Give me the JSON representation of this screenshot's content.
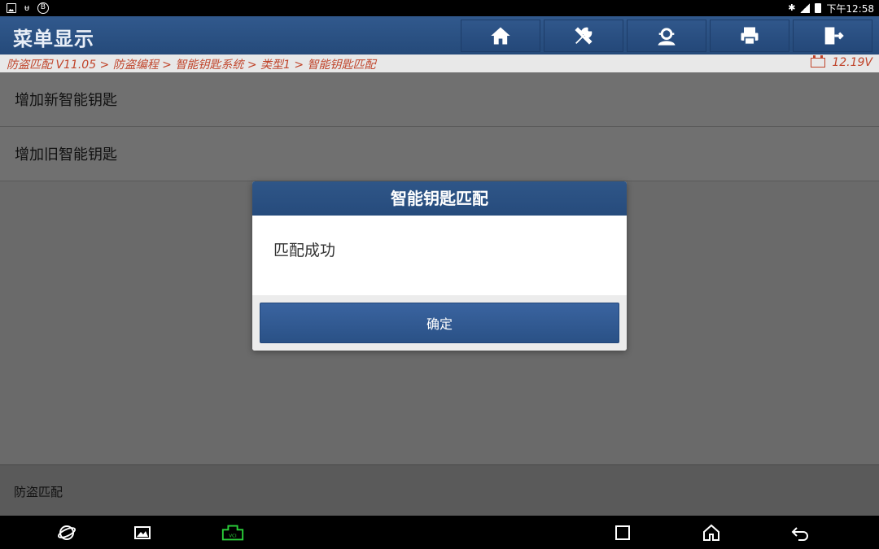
{
  "status_bar": {
    "left_icons": [
      "image-icon",
      "usb-icon",
      "bluetooth-circle-icon"
    ],
    "usb_glyph": "ᵾ",
    "bt_glyph": "B",
    "time": "下午12:58",
    "bluetooth_glyph": "✱"
  },
  "header": {
    "title": "菜单显示",
    "tools": [
      "home-icon",
      "diagnostic-icon",
      "user-icon",
      "print-icon",
      "exit-icon"
    ]
  },
  "breadcrumb": {
    "path": "防盗匹配 V11.05 > 防盗编程 > 智能钥匙系统 > 类型1 > 智能钥匙匹配",
    "voltage": "12.19V"
  },
  "menu": {
    "items": [
      {
        "label": "增加新智能钥匙"
      },
      {
        "label": "增加旧智能钥匙"
      }
    ]
  },
  "footer": {
    "label": "防盗匹配"
  },
  "dialog": {
    "title": "智能钥匙匹配",
    "message": "匹配成功",
    "ok_label": "确定"
  },
  "navbar": {
    "icons": [
      "browser-icon",
      "gallery-icon",
      "vci-icon",
      "recent-apps-icon",
      "home-nav-icon",
      "back-icon"
    ],
    "vci_label": "VCI"
  },
  "colors": {
    "header_blue": "#2b5283",
    "breadcrumb_red": "#c0442a",
    "overlay_gray": "#6a6a6a",
    "vci_green": "#2bd13a"
  }
}
